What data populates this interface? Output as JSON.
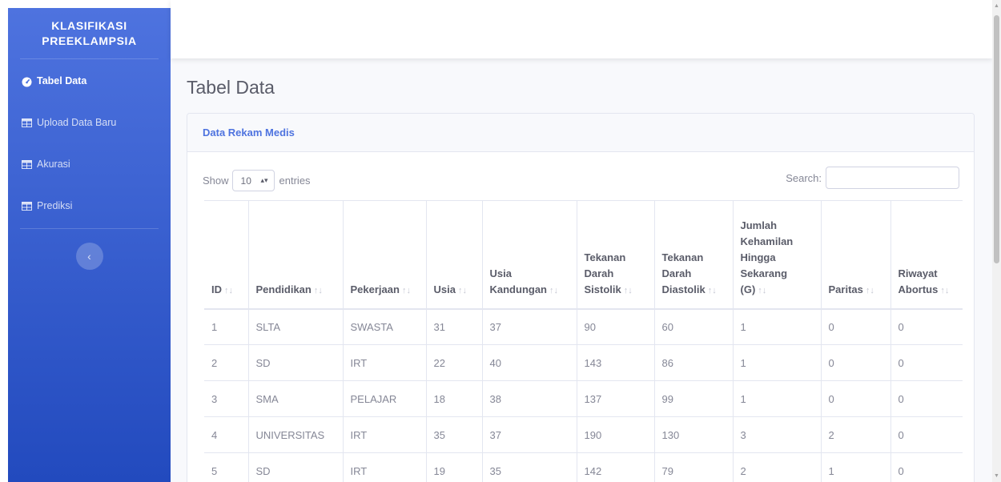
{
  "brand": {
    "line1": "KLASIFIKASI",
    "line2": "PREEKLAMPSIA"
  },
  "sidebar": {
    "items": [
      {
        "label": "Tabel Data",
        "icon": "tachometer-icon",
        "active": true
      },
      {
        "label": "Upload Data Baru",
        "icon": "table-icon",
        "active": false
      },
      {
        "label": "Akurasi",
        "icon": "table-icon",
        "active": false
      },
      {
        "label": "Prediksi",
        "icon": "table-icon",
        "active": false
      }
    ],
    "toggle_glyph": "‹"
  },
  "page": {
    "title": "Tabel Data"
  },
  "card": {
    "header": "Data Rekam Medis",
    "show_label": "Show",
    "entries_value": "10",
    "entries_label": "entries",
    "search_label": "Search:",
    "search_value": ""
  },
  "table": {
    "sort_glyph": "↑↓",
    "columns": [
      [
        "ID"
      ],
      [
        "Pendidikan"
      ],
      [
        "Pekerjaan"
      ],
      [
        "Usia"
      ],
      [
        "Usia",
        "Kandungan"
      ],
      [
        "Tekanan",
        "Darah",
        "Sistolik"
      ],
      [
        "Tekanan",
        "Darah",
        "Diastolik"
      ],
      [
        "Jumlah",
        "Kehamilan",
        "Hingga",
        "Sekarang",
        "(G)"
      ],
      [
        "Paritas"
      ],
      [
        "Riwayat",
        "Abortus"
      ]
    ],
    "rows": [
      [
        "1",
        "SLTA",
        "SWASTA",
        "31",
        "37",
        "90",
        "60",
        "1",
        "0",
        "0"
      ],
      [
        "2",
        "SD",
        "IRT",
        "22",
        "40",
        "143",
        "86",
        "1",
        "0",
        "0"
      ],
      [
        "3",
        "SMA",
        "PELAJAR",
        "18",
        "38",
        "137",
        "99",
        "1",
        "0",
        "0"
      ],
      [
        "4",
        "UNIVERSITAS",
        "IRT",
        "35",
        "37",
        "190",
        "130",
        "3",
        "2",
        "0"
      ],
      [
        "5",
        "SD",
        "IRT",
        "19",
        "35",
        "142",
        "79",
        "2",
        "1",
        "0"
      ]
    ]
  },
  "colors": {
    "sidebar_gradient_top": "#4e73df",
    "sidebar_gradient_bottom": "#224abe",
    "accent": "#4e73df",
    "text_muted": "#858796",
    "text_heading": "#5a5c69"
  }
}
